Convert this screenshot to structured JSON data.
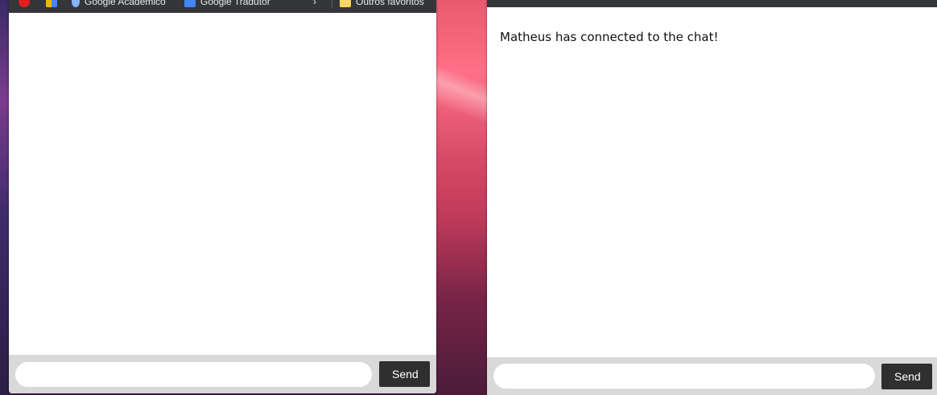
{
  "left_window": {
    "bookmarks": [
      {
        "label": "Google Acadêmico",
        "icon": "scholar-icon",
        "color": "#8ab4f8"
      },
      {
        "label": "Google Tradutor",
        "icon": "translate-icon",
        "color": "#4285f4"
      },
      {
        "label": "Outros favoritos",
        "icon": "folder-icon",
        "color": "#fdd663"
      }
    ],
    "input": {
      "value": "",
      "placeholder": ""
    },
    "send_label": "Send"
  },
  "right_window": {
    "messages": [
      "Matheus has connected to the chat!"
    ],
    "input": {
      "value": "",
      "placeholder": ""
    },
    "send_label": "Send"
  },
  "colors": {
    "bookmarks_bar": "#35363a",
    "composer_bg": "#d9d9d9",
    "send_button": "#2f2f2f"
  }
}
